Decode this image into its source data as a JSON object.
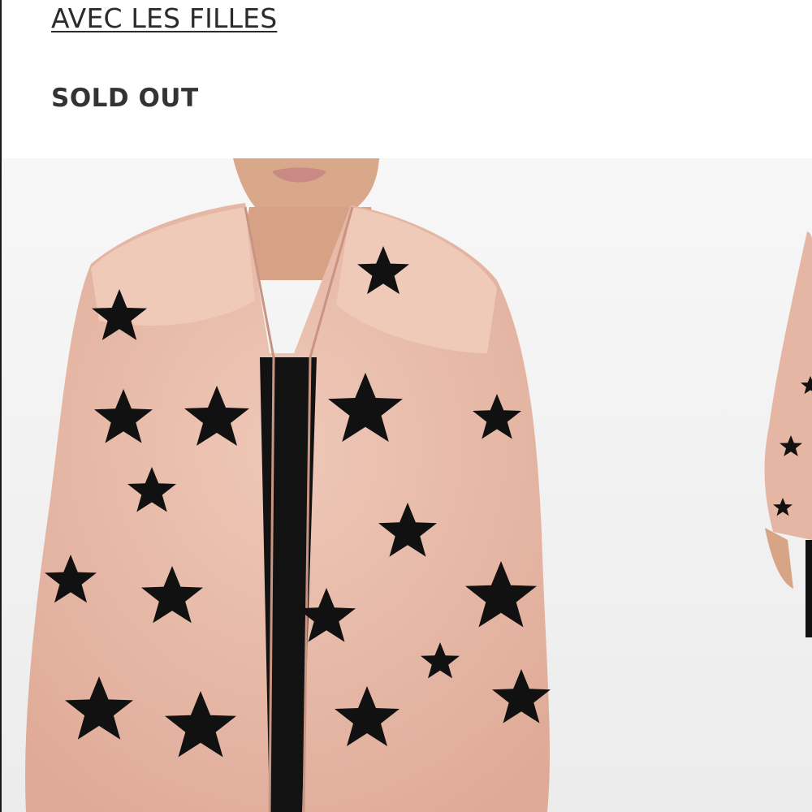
{
  "product": {
    "brand": "AVEC LES FILLES",
    "status": "SOLD OUT"
  },
  "gallery": {
    "main_image": {
      "subject": "pink faux fur coat with black stars"
    },
    "next_image": {
      "subject": "coat side view preview"
    }
  },
  "colors": {
    "coat": "#e6b6a4",
    "stars": "#111111",
    "text": "#2b2b2b"
  },
  "icons": [
    "star-icon"
  ]
}
